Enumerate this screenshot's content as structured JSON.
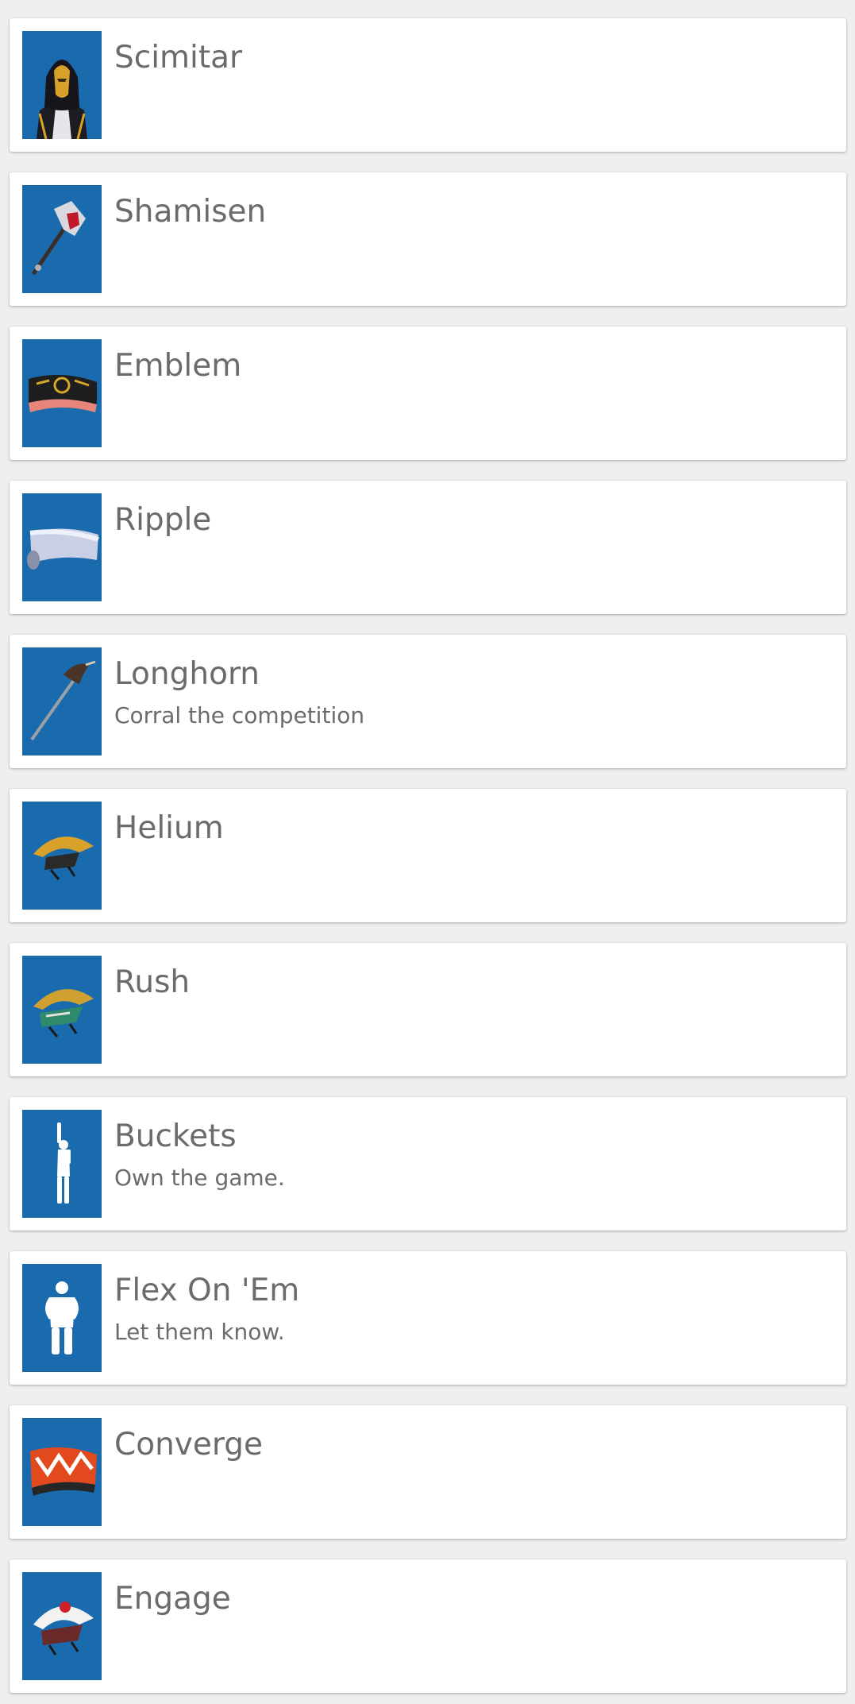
{
  "thumbnail_color": "#1a6bad",
  "items": [
    {
      "name": "Scimitar",
      "description": "",
      "icon": "hooded-outfit-icon"
    },
    {
      "name": "Shamisen",
      "description": "",
      "icon": "pickaxe-icon"
    },
    {
      "name": "Emblem",
      "description": "",
      "icon": "wrap-icon"
    },
    {
      "name": "Ripple",
      "description": "",
      "icon": "wrap-icon"
    },
    {
      "name": "Longhorn",
      "description": "Corral the competition",
      "icon": "pickaxe-icon"
    },
    {
      "name": "Helium",
      "description": "",
      "icon": "glider-icon"
    },
    {
      "name": "Rush",
      "description": "",
      "icon": "glider-icon"
    },
    {
      "name": "Buckets",
      "description": "Own the game.",
      "icon": "emote-silhouette-icon"
    },
    {
      "name": "Flex On 'Em",
      "description": "Let them know.",
      "icon": "emote-silhouette-icon"
    },
    {
      "name": "Converge",
      "description": "",
      "icon": "wrap-icon"
    },
    {
      "name": "Engage",
      "description": "",
      "icon": "glider-icon"
    }
  ]
}
